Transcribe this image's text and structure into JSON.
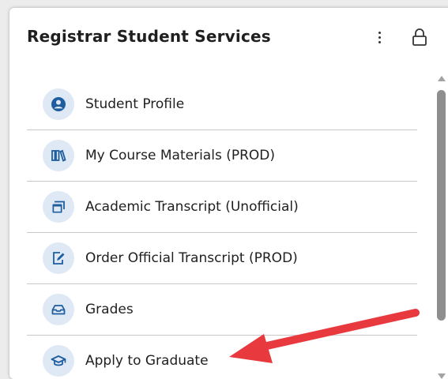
{
  "card": {
    "title": "Registrar Student Services",
    "menu_icon": "kebab-menu-icon",
    "lock_icon": "lock-icon"
  },
  "items": [
    {
      "label": "Student Profile",
      "icon": "user-profile-icon"
    },
    {
      "label": "My Course Materials (PROD)",
      "icon": "books-icon"
    },
    {
      "label": "Academic Transcript (Unofficial)",
      "icon": "windows-icon"
    },
    {
      "label": "Order Official Transcript (PROD)",
      "icon": "document-edit-icon"
    },
    {
      "label": "Grades",
      "icon": "inbox-tray-icon"
    },
    {
      "label": "Apply to Graduate",
      "icon": "graduation-cap-icon"
    }
  ],
  "colors": {
    "icon_color": "#1f5e9e",
    "icon_background": "#dfe9f5",
    "annotation_arrow": "#e8393f"
  }
}
